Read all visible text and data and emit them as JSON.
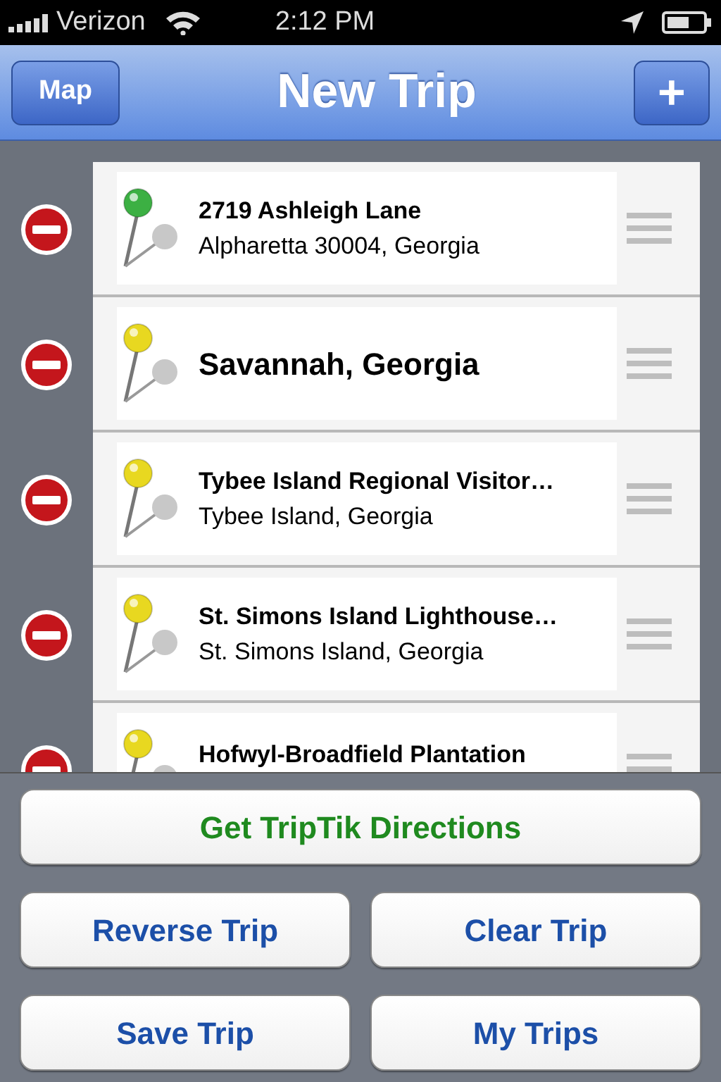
{
  "status_bar": {
    "carrier": "Verizon",
    "time": "2:12 PM"
  },
  "nav": {
    "left_button": "Map",
    "title": "New Trip",
    "right_button": "+"
  },
  "stops": [
    {
      "kind": "double",
      "title": "2719 Ashleigh Lane",
      "subtitle": "Alpharetta 30004, Georgia",
      "color": "#3cb043"
    },
    {
      "kind": "single",
      "title": "Savannah, Georgia",
      "color": "#e8d820"
    },
    {
      "kind": "double",
      "title": "Tybee Island Regional Visitor…",
      "subtitle": "Tybee Island, Georgia",
      "color": "#e8d820"
    },
    {
      "kind": "double",
      "title": "St. Simons Island Lighthouse…",
      "subtitle": "St. Simons Island, Georgia",
      "color": "#e8d820"
    },
    {
      "kind": "double",
      "title": "Hofwyl-Broadfield Plantation",
      "color": "#e8d820"
    }
  ],
  "primary_button": "Get TripTik Directions",
  "buttons": [
    "Reverse Trip",
    "Clear Trip",
    "Save Trip",
    "My Trips"
  ]
}
